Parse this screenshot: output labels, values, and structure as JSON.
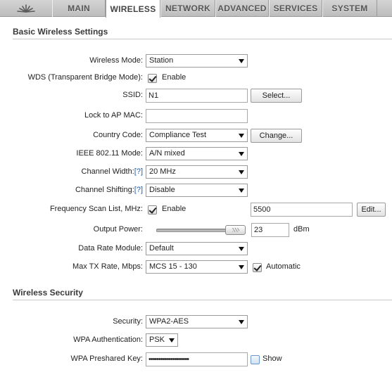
{
  "nav": {
    "logo_icon": "ubiquiti-logo-icon",
    "tabs": [
      {
        "label": "MAIN"
      },
      {
        "label": "WIRELESS",
        "active": true
      },
      {
        "label": "NETWORK"
      },
      {
        "label": "ADVANCED"
      },
      {
        "label": "SERVICES"
      },
      {
        "label": "SYSTEM"
      }
    ]
  },
  "basic": {
    "title": "Basic Wireless Settings",
    "wireless_mode": {
      "label": "Wireless Mode:",
      "value": "Station"
    },
    "wds": {
      "label": "WDS (Transparent Bridge Mode):",
      "checked": true,
      "text": "Enable"
    },
    "ssid": {
      "label": "SSID:",
      "value": "N1",
      "button": "Select..."
    },
    "lock_ap_mac": {
      "label": "Lock to AP MAC:",
      "value": ""
    },
    "country_code": {
      "label": "Country Code:",
      "value": "Compliance Test",
      "button": "Change..."
    },
    "ieee_mode": {
      "label": "IEEE 802.11 Mode:",
      "value": "A/N mixed"
    },
    "channel_width": {
      "label": "Channel Width:",
      "help": "[?]",
      "value": "20 MHz"
    },
    "channel_shifting": {
      "label": "Channel Shifting:",
      "help": "[?]",
      "value": "Disable"
    },
    "freq_scan": {
      "label": "Frequency Scan List, MHz:",
      "checked": true,
      "text": "Enable",
      "value": "5500",
      "button": "Edit..."
    },
    "output_power": {
      "label": "Output Power:",
      "value": "23",
      "unit": "dBm",
      "slider_fraction": 0.9
    },
    "data_rate_module": {
      "label": "Data Rate Module:",
      "value": "Default"
    },
    "max_tx_rate": {
      "label": "Max TX Rate, Mbps:",
      "value": "MCS 15 - 130",
      "auto_checked": true,
      "auto_text": "Automatic"
    }
  },
  "security": {
    "title": "Wireless Security",
    "security": {
      "label": "Security:",
      "value": "WPA2-AES"
    },
    "wpa_auth": {
      "label": "WPA Authentication:",
      "value": "PSK"
    },
    "wpa_key": {
      "label": "WPA Preshared Key:",
      "value": "••••••••••••••••••••",
      "show_checked": false,
      "show_text": "Show"
    }
  }
}
